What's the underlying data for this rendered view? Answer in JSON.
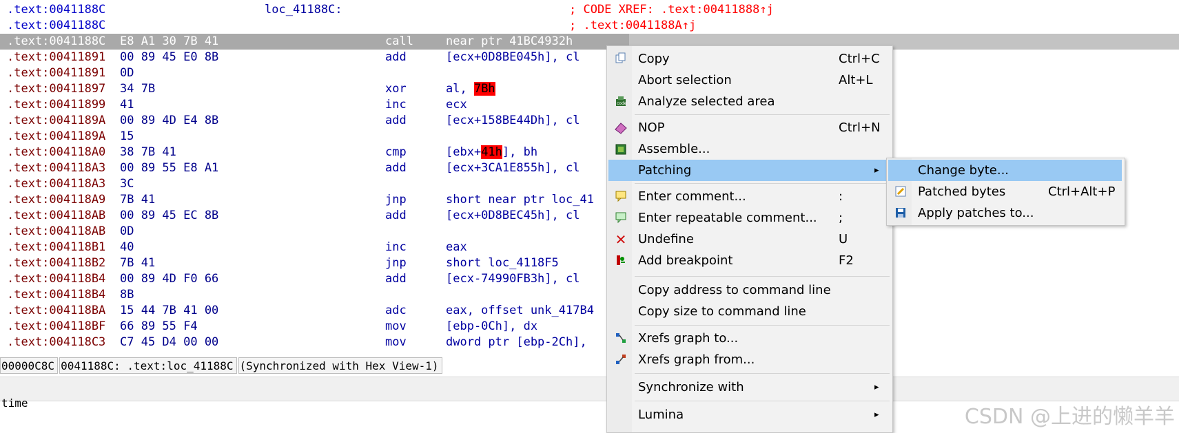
{
  "listing": {
    "header": [
      {
        "addr": ".text:0041188C",
        "label": "loc_41188C:",
        "xref": "; CODE XREF: .text:00411888↑j"
      },
      {
        "addr": ".text:0041188C",
        "label": "",
        "xref": "; .text:0041188A↑j"
      }
    ],
    "selected_row": {
      "addr": ".text:0041188C",
      "bytes": "E8 A1 30 7B 41",
      "mnem": "call",
      "opnd": "near ptr 41BC4932h"
    },
    "rows": [
      {
        "addr": ".text:00411891",
        "bytes": "00 89 45 E0 8B",
        "mnem": "add",
        "opnd": "[ecx+0D8BE045h], cl"
      },
      {
        "addr": ".text:00411891",
        "bytes": "0D",
        "mnem": "",
        "opnd": ""
      },
      {
        "addr": ".text:00411897",
        "bytes": "34 7B",
        "mnem": "xor",
        "opnd": "al, ",
        "hl": "7Bh",
        "after": ""
      },
      {
        "addr": ".text:00411899",
        "bytes": "41",
        "mnem": "inc",
        "opnd": "ecx"
      },
      {
        "addr": ".text:0041189A",
        "bytes": "00 89 4D E4 8B",
        "mnem": "add",
        "opnd": "[ecx+158BE44Dh], cl"
      },
      {
        "addr": ".text:0041189A",
        "bytes": "15",
        "mnem": "",
        "opnd": ""
      },
      {
        "addr": ".text:004118A0",
        "bytes": "38 7B 41",
        "mnem": "cmp",
        "opnd": "[ebx+",
        "hl": "41h",
        "after": "], bh"
      },
      {
        "addr": ".text:004118A3",
        "bytes": "00 89 55 E8 A1",
        "mnem": "add",
        "opnd": "[ecx+3CA1E855h], cl"
      },
      {
        "addr": ".text:004118A3",
        "bytes": "3C",
        "mnem": "",
        "opnd": ""
      },
      {
        "addr": ".text:004118A9",
        "bytes": "7B 41",
        "mnem": "jnp",
        "opnd": "short near ptr loc_41"
      },
      {
        "addr": ".text:004118AB",
        "bytes": "00 89 45 EC 8B",
        "mnem": "add",
        "opnd": "[ecx+0D8BEC45h], cl"
      },
      {
        "addr": ".text:004118AB",
        "bytes": "0D",
        "mnem": "",
        "opnd": ""
      },
      {
        "addr": ".text:004118B1",
        "bytes": "40",
        "mnem": "inc",
        "opnd": "eax"
      },
      {
        "addr": ".text:004118B2",
        "bytes": "7B 41",
        "mnem": "jnp",
        "opnd": "short loc_4118F5"
      },
      {
        "addr": ".text:004118B4",
        "bytes": "00 89 4D F0 66",
        "mnem": "add",
        "opnd": "[ecx-74990FB3h], cl"
      },
      {
        "addr": ".text:004118B4",
        "bytes": "8B",
        "mnem": "",
        "opnd": ""
      },
      {
        "addr": ".text:004118BA",
        "bytes": "15 44 7B 41 00",
        "mnem": "adc",
        "opnd": "eax, offset unk_417B4"
      },
      {
        "addr": ".text:004118BF",
        "bytes": "66 89 55 F4",
        "mnem": "mov",
        "opnd": "[ebp-0Ch], dx"
      },
      {
        "addr": ".text:004118C3",
        "bytes": "C7 45 D4 00 00",
        "mnem": "mov",
        "opnd": "dword ptr [ebp-2Ch],"
      }
    ]
  },
  "status": {
    "offset": "00000C8C",
    "location": "0041188C: .text:loc_41188C",
    "sync": "(Synchronized with Hex View-1)"
  },
  "output_label": "time",
  "watermark": "CSDN @上进的懒羊羊",
  "context_menu": {
    "items": [
      {
        "label": "Copy",
        "shortcut": "Ctrl+C",
        "icon": "copy-icon"
      },
      {
        "label": "Abort selection",
        "shortcut": "Alt+L",
        "icon": ""
      },
      {
        "label": "Analyze selected area",
        "shortcut": "",
        "icon": "analyze-icon"
      },
      {
        "label": "NOP",
        "shortcut": "Ctrl+N",
        "icon": "eraser-icon"
      },
      {
        "label": "Assemble...",
        "shortcut": "",
        "icon": "chip-icon"
      },
      {
        "label": "Patching",
        "shortcut": "",
        "icon": ""
      },
      {
        "label": "Enter comment...",
        "shortcut": ":",
        "icon": "comment-icon"
      },
      {
        "label": "Enter repeatable comment...",
        "shortcut": ";",
        "icon": "repeatable-comment-icon"
      },
      {
        "label": "Undefine",
        "shortcut": "U",
        "icon": "x-icon"
      },
      {
        "label": "Add breakpoint",
        "shortcut": "F2",
        "icon": "breakpoint-icon"
      },
      {
        "label": "Copy address to command line",
        "shortcut": "",
        "icon": ""
      },
      {
        "label": "Copy size to command line",
        "shortcut": "",
        "icon": ""
      },
      {
        "label": "Xrefs graph to...",
        "shortcut": "",
        "icon": "xrefs-to-icon"
      },
      {
        "label": "Xrefs graph from...",
        "shortcut": "",
        "icon": "xrefs-from-icon"
      },
      {
        "label": "Synchronize with",
        "shortcut": "",
        "icon": ""
      },
      {
        "label": "Lumina",
        "shortcut": "",
        "icon": ""
      }
    ],
    "submenu_arrow": "▸"
  },
  "patching_submenu": {
    "items": [
      {
        "label": "Change byte...",
        "shortcut": "",
        "icon": ""
      },
      {
        "label": "Patched bytes",
        "shortcut": "Ctrl+Alt+P",
        "icon": "pencil-icon"
      },
      {
        "label": "Apply patches to...",
        "shortcut": "",
        "icon": "save-icon"
      }
    ]
  },
  "colors": {
    "selection_highlight": "#99c9f3",
    "operand_highlight": "#ff0000",
    "xref_text": "#ff0000",
    "address_header": "#0000c8",
    "address_code": "#7b0000"
  }
}
